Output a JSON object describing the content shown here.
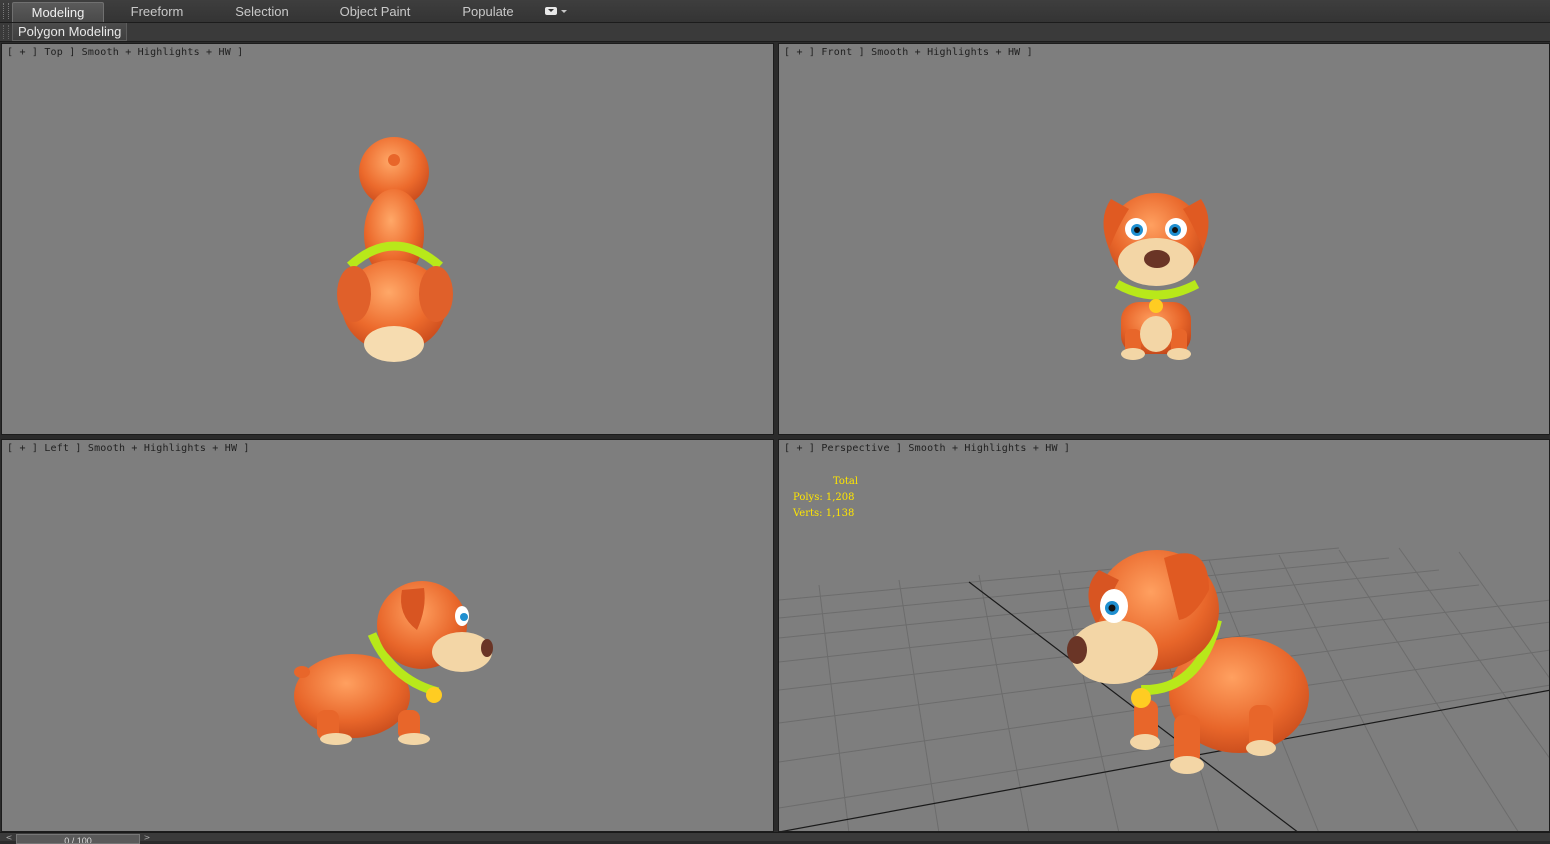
{
  "ribbon": {
    "tabs": [
      {
        "label": "Modeling",
        "active": true
      },
      {
        "label": "Freeform",
        "active": false
      },
      {
        "label": "Selection",
        "active": false
      },
      {
        "label": "Object Paint",
        "active": false
      },
      {
        "label": "Populate",
        "active": false
      }
    ],
    "panel_label": "Polygon Modeling",
    "options_icon": "ribbon-options-dropdown-icon"
  },
  "viewports": {
    "top": {
      "label": "[ + ] Top ] Smooth + Highlights + HW ]"
    },
    "front": {
      "label": "[ + ] Front ] Smooth + Highlights + HW ]"
    },
    "left": {
      "label": "[ + ] Left ] Smooth + Highlights + HW ]"
    },
    "perspective": {
      "label": "[ + ] Perspective ] Smooth + Highlights + HW ]",
      "stats": {
        "title": "Total",
        "polys": "Polys: 1,208",
        "verts": "Verts: 1,138"
      }
    }
  },
  "colors": {
    "viewport_bg": "#7e7e7e",
    "stats_text": "#ffe600",
    "dog_body": "#e8662a",
    "dog_muzzle": "#f3d6a6",
    "collar": "#b8e81a"
  },
  "timeline": {
    "frame": "0 / 100"
  }
}
